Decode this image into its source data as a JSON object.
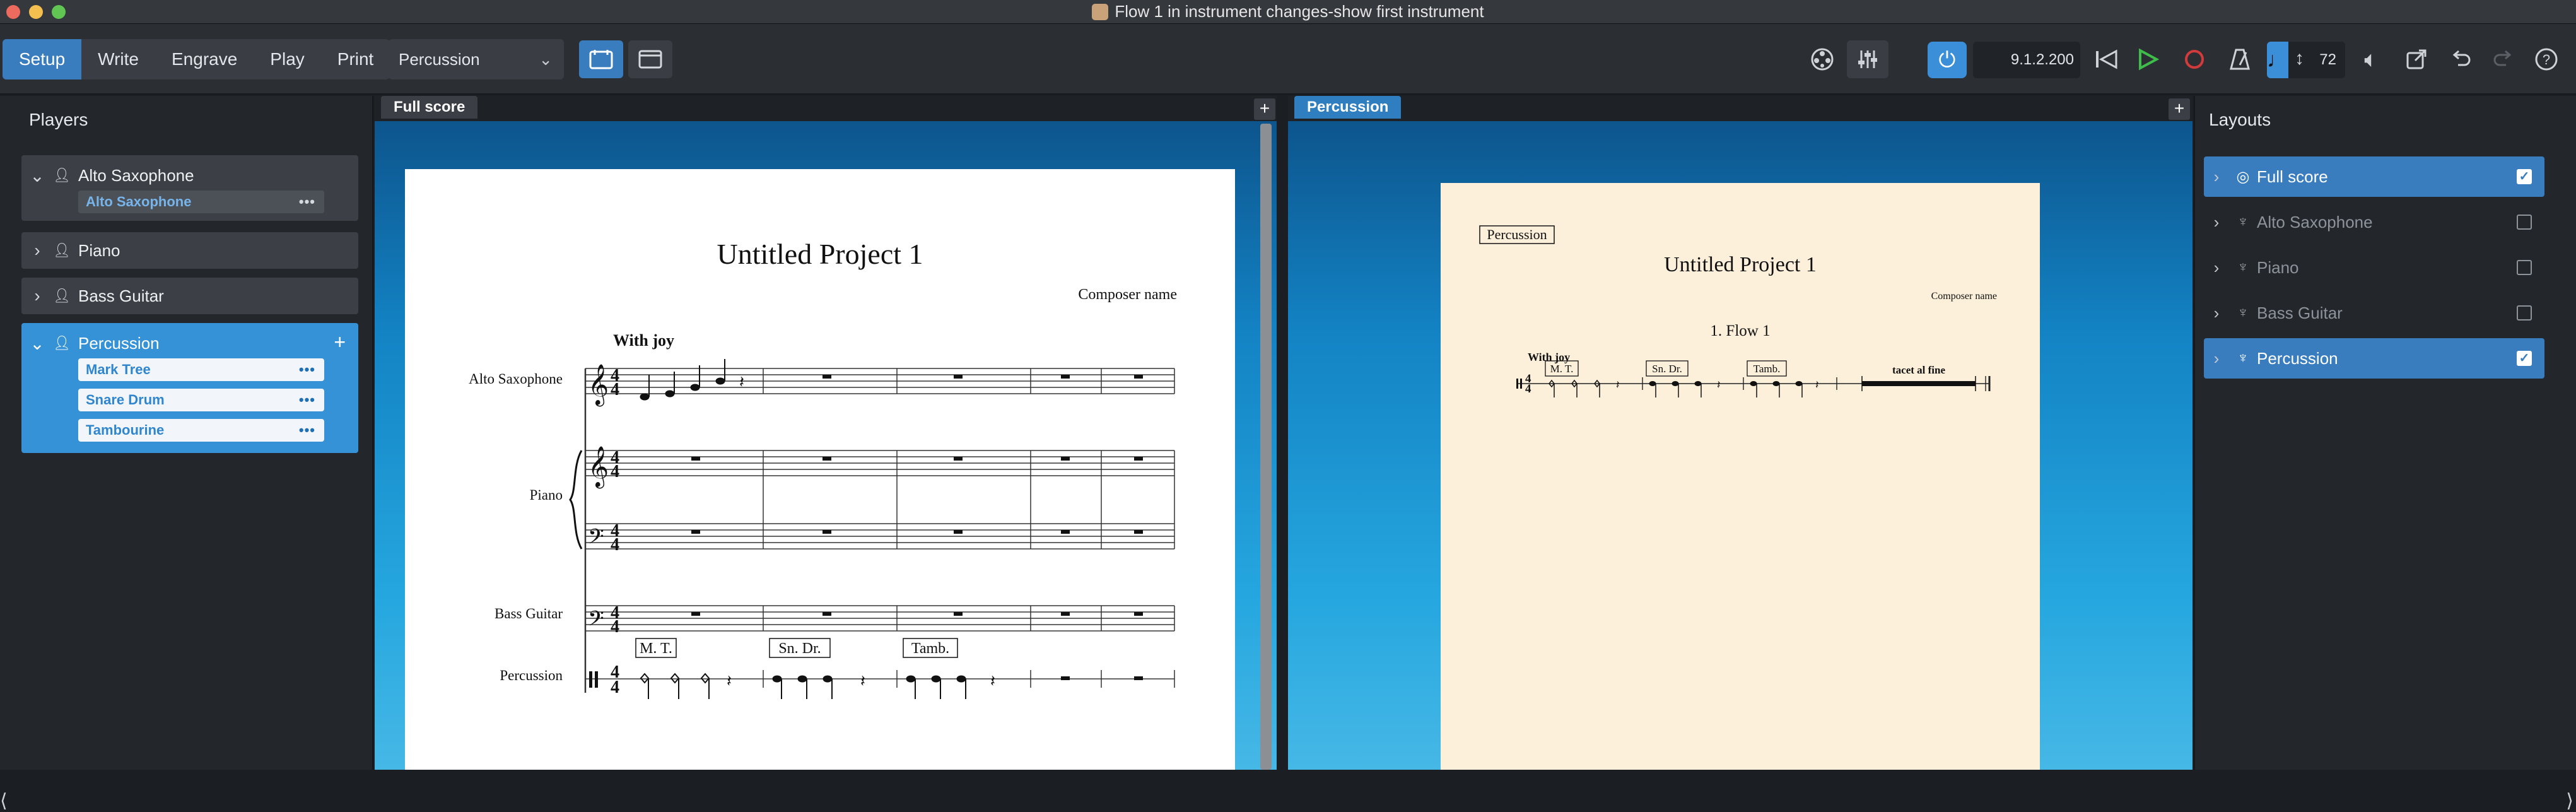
{
  "window": {
    "title": "Flow 1 in instrument changes-show first instrument"
  },
  "toolbar": {
    "modes": [
      "Setup",
      "Write",
      "Engrave",
      "Play",
      "Print"
    ],
    "active_mode": "Setup",
    "layout_select": "Percussion",
    "timecode": "9.1.2.200",
    "tempo": "72"
  },
  "players_panel": {
    "heading": "Players",
    "players": [
      {
        "name": "Alto Saxophone",
        "expanded": true,
        "instruments": [
          "Alto Saxophone"
        ]
      },
      {
        "name": "Piano",
        "expanded": false
      },
      {
        "name": "Bass Guitar",
        "expanded": false
      },
      {
        "name": "Percussion",
        "expanded": true,
        "selected": true,
        "instruments": [
          "Mark Tree",
          "Snare Drum",
          "Tambourine"
        ]
      }
    ]
  },
  "left_tab": "Full score",
  "right_tab": "Percussion",
  "full_score": {
    "title": "Untitled Project 1",
    "composer": "Composer name",
    "tempo_text": "With joy",
    "staff_labels": [
      "Alto Saxophone",
      "Piano",
      "Bass Guitar",
      "Percussion"
    ],
    "instrument_boxes": [
      "M. T.",
      "Sn. Dr.",
      "Tamb."
    ]
  },
  "part": {
    "part_name": "Percussion",
    "title": "Untitled Project 1",
    "composer": "Composer name",
    "flow_title": "1. Flow 1",
    "tempo_text": "With joy",
    "instrument_boxes": [
      "M. T.",
      "Sn. Dr.",
      "Tamb."
    ],
    "tacet": "tacet al fine"
  },
  "layouts_panel": {
    "heading": "Layouts",
    "items": [
      {
        "name": "Full score",
        "checked": true,
        "active": true
      },
      {
        "name": "Alto Saxophone",
        "checked": false
      },
      {
        "name": "Piano",
        "checked": false
      },
      {
        "name": "Bass Guitar",
        "checked": false
      },
      {
        "name": "Percussion",
        "checked": true,
        "active": true
      }
    ]
  },
  "colors": {
    "accent": "#3a7dbe",
    "part_paper": "#fcf0da",
    "score_bg": "#1383c4"
  }
}
